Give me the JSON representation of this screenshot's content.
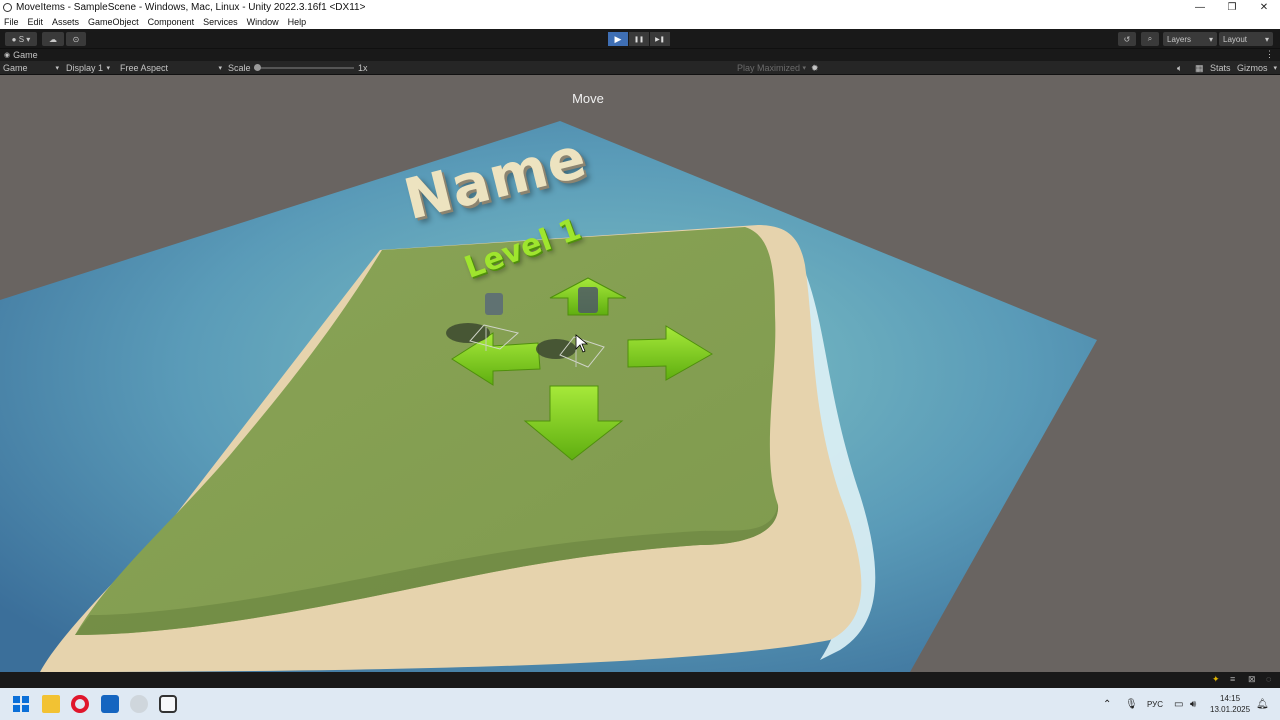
{
  "window": {
    "title": "MoveItems - SampleScene - Windows, Mac, Linux - Unity 2022.3.16f1 <DX11>",
    "controls": {
      "minimize": "—",
      "maximize": "❐",
      "close": "✕"
    }
  },
  "menu": [
    "File",
    "Edit",
    "Assets",
    "GameObject",
    "Component",
    "Services",
    "Window",
    "Help"
  ],
  "toolbar": {
    "account_label": "S",
    "layers_label": "Layers",
    "layout_label": "Layout",
    "play": "▶",
    "pause": "❚❚",
    "step": "▶❚"
  },
  "tab": {
    "label": "Game"
  },
  "gamebar": {
    "mode": "Game",
    "display": "Display 1",
    "aspect": "Free Aspect",
    "scale_label": "Scale",
    "scale_value": "1x",
    "play_maximized": "Play Maximized",
    "stats": "Stats",
    "gizmos": "Gizmos"
  },
  "game": {
    "move_label": "Move",
    "title_text": "Name",
    "level_text": "Level 1"
  },
  "taskbar": {
    "language": "РУС",
    "time": "14:15",
    "date": "13.01.2025"
  },
  "colors": {
    "play_active": "#3f6fb4",
    "grass": "#8ca85a",
    "sand": "#e6d3ad",
    "water": "#4f86a8",
    "arrow": "#86d41a"
  }
}
